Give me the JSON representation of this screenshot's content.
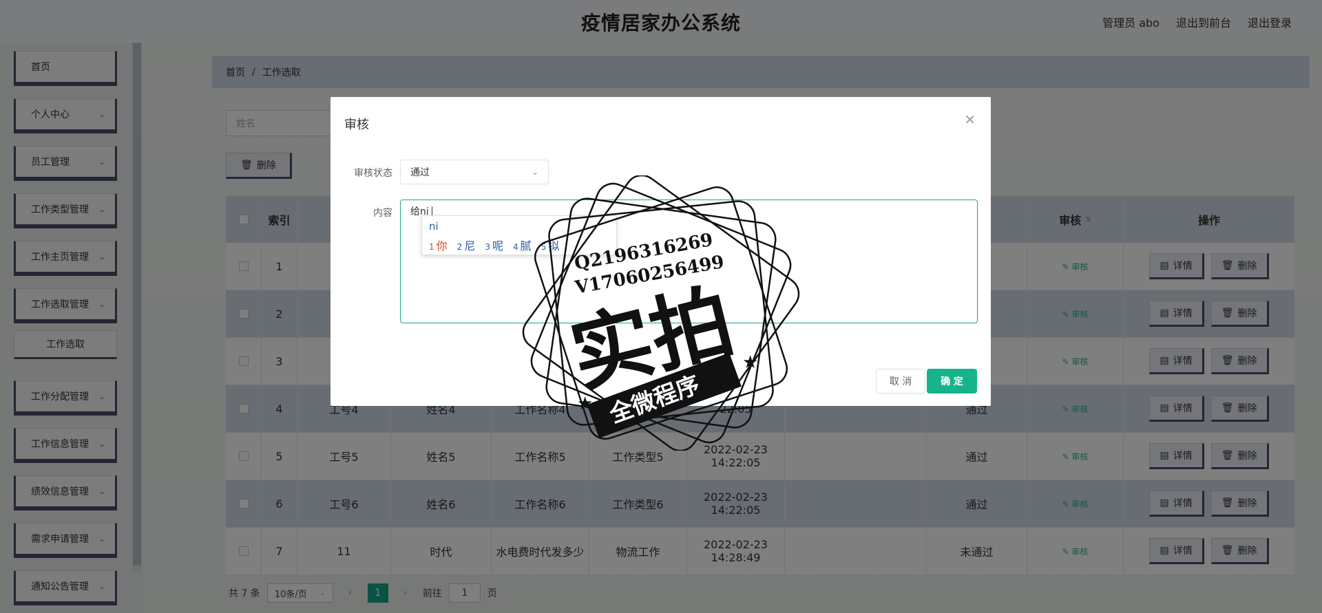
{
  "header": {
    "title": "疫情居家办公系统",
    "admin_label": "管理员 abo",
    "to_front": "退出到前台",
    "logout": "退出登录"
  },
  "sidebar": {
    "items": [
      {
        "label": "首页",
        "has_arrow": false
      },
      {
        "label": "个人中心",
        "has_arrow": true
      },
      {
        "label": "员工管理",
        "has_arrow": true
      },
      {
        "label": "工作类型管理",
        "has_arrow": true
      },
      {
        "label": "工作主页管理",
        "has_arrow": true
      },
      {
        "label": "工作选取管理",
        "has_arrow": true
      },
      {
        "label": "工作分配管理",
        "has_arrow": true
      },
      {
        "label": "工作信息管理",
        "has_arrow": true
      },
      {
        "label": "绩效信息管理",
        "has_arrow": true
      },
      {
        "label": "需求申请管理",
        "has_arrow": true
      },
      {
        "label": "通知公告管理",
        "has_arrow": true
      }
    ],
    "sub_item": "工作选取"
  },
  "breadcrumb": {
    "home": "首页",
    "sep": "/",
    "current": "工作选取"
  },
  "search": {
    "placeholder": "姓名"
  },
  "toolbar": {
    "delete_label": "删除"
  },
  "table": {
    "headers": {
      "index": "索引",
      "audit": "审核",
      "ops": "操作"
    },
    "rows": [
      {
        "index": "1",
        "work_no": "",
        "name": "",
        "work_name": "",
        "work_type": "",
        "time": "",
        "extra": "",
        "status": "",
        "audit": "审核"
      },
      {
        "index": "2",
        "work_no": "",
        "name": "",
        "work_name": "",
        "work_type": "",
        "time": "",
        "extra": "",
        "status": "",
        "audit": "审核"
      },
      {
        "index": "3",
        "work_no": "",
        "name": "",
        "work_name": "",
        "work_type": "",
        "time": "",
        "extra": "",
        "status": "",
        "audit": "审核"
      },
      {
        "index": "4",
        "work_no": "工号4",
        "name": "姓名4",
        "work_name": "工作名称4",
        "work_type": "",
        "time": "22:05",
        "extra": "",
        "status": "通过",
        "audit": "审核"
      },
      {
        "index": "5",
        "work_no": "工号5",
        "name": "姓名5",
        "work_name": "工作名称5",
        "work_type": "工作类型5",
        "time": "2022-02-23 14:22:05",
        "extra": "",
        "status": "通过",
        "audit": "审核"
      },
      {
        "index": "6",
        "work_no": "工号6",
        "name": "姓名6",
        "work_name": "工作名称6",
        "work_type": "工作类型6",
        "time": "2022-02-23 14:22:05",
        "extra": "",
        "status": "通过",
        "audit": "审核"
      },
      {
        "index": "7",
        "work_no": "11",
        "name": "时代",
        "work_name": "水电费时代发多少",
        "work_type": "物流工作",
        "time": "2022-02-23 14:28:49",
        "extra": "",
        "status": "未通过",
        "audit": "审核"
      }
    ],
    "detail_label": "详情",
    "delete_label": "删除"
  },
  "pagination": {
    "total": "共 7 条",
    "page_size": "10条/页",
    "current_page": "1",
    "goto_prefix": "前往",
    "goto_value": "1",
    "goto_suffix": "页"
  },
  "modal": {
    "title": "审核",
    "status_label": "审核状态",
    "status_value": "通过",
    "content_label": "内容",
    "content_value": "给ni",
    "ime": {
      "code": "ni",
      "candidates": [
        {
          "n": "1",
          "t": "你"
        },
        {
          "n": "2",
          "t": "尼"
        },
        {
          "n": "3",
          "t": "呢"
        },
        {
          "n": "4",
          "t": "腻"
        },
        {
          "n": "5",
          "t": "拟"
        }
      ]
    },
    "cancel": "取 消",
    "confirm": "确 定"
  },
  "watermark": {
    "line1": "Q2196316269",
    "line2": "V17060256499",
    "big": "实拍",
    "banner": "全微程序"
  },
  "colors": {
    "accent": "#17b48b",
    "nav_border": "#4c4b6a",
    "row_alt": "#cfdbe5"
  }
}
